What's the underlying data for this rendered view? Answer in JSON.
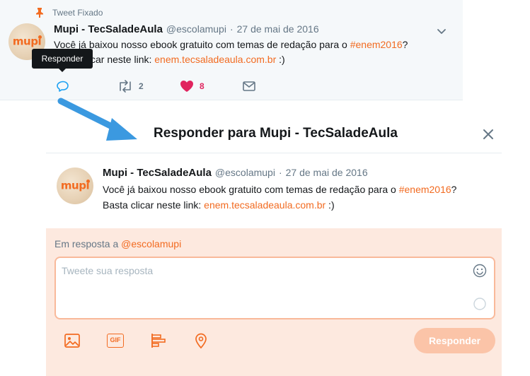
{
  "pinned": {
    "label": "Tweet Fixado",
    "avatar_text": "mupi",
    "name": "Mupi - TecSaladeAula",
    "handle": "@escolamupi",
    "separator": "·",
    "date": "27 de mai de 2016",
    "line1_text": "Você já baixou nosso ebook gratuito com temas de redação para o ",
    "line1_hashtag": "#enem2016",
    "line1_end": "?",
    "line2_text": "car neste link: ",
    "line2_link": "enem.tecsaladeaula.com.br",
    "line2_end": " :)",
    "retweet_count": "2",
    "like_count": "8"
  },
  "tooltip": "Responder",
  "modal": {
    "title": "Responder para Mupi - TecSaladeAula",
    "tweet": {
      "avatar_text": "mupi",
      "name": "Mupi - TecSaladeAula",
      "handle": "@escolamupi",
      "separator": "·",
      "date": "27 de mai de 2016",
      "line1_text": "Você já baixou nosso ebook gratuito com temas de redação para o ",
      "line1_hashtag": "#enem2016",
      "line1_end": "?",
      "line2_text": "Basta clicar neste link: ",
      "line2_link": "enem.tecsaladeaula.com.br",
      "line2_end": " :)"
    },
    "reply_to_label": "Em resposta a ",
    "reply_to_handle": "@escolamupi",
    "placeholder": "Tweete sua resposta",
    "gif_label": "GIF",
    "submit_label": "Responder"
  },
  "colors": {
    "accent": "#f26b21",
    "like": "#e0245e",
    "arrow": "#3b99e0",
    "reply_bg": "#fde9df"
  }
}
